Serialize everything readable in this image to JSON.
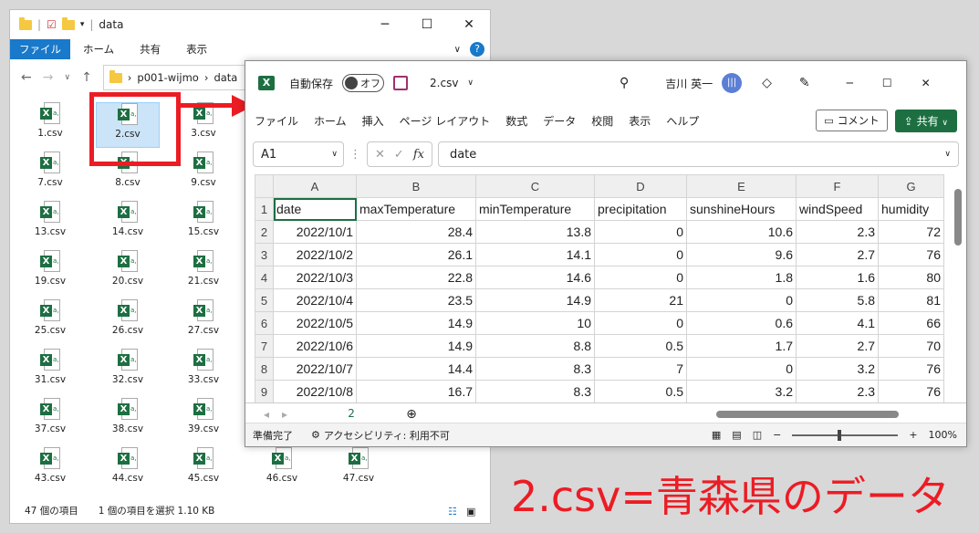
{
  "explorer": {
    "title": "data",
    "tabs": [
      "ファイル",
      "ホーム",
      "共有",
      "表示"
    ],
    "breadcrumb": [
      "p001-wijmo",
      "data"
    ],
    "files": [
      "1.csv",
      "2.csv",
      "3.csv",
      "7.csv",
      "8.csv",
      "9.csv",
      "13.csv",
      "14.csv",
      "15.csv",
      "19.csv",
      "20.csv",
      "21.csv",
      "25.csv",
      "26.csv",
      "27.csv",
      "31.csv",
      "32.csv",
      "33.csv",
      "37.csv",
      "38.csv",
      "39.csv",
      "43.csv",
      "44.csv",
      "45.csv",
      "46.csv",
      "47.csv"
    ],
    "selected_file": "2.csv",
    "status_count": "47 個の項目",
    "status_selected": "1 個の項目を選択  1.10 KB"
  },
  "excel": {
    "autosave_label": "自動保存",
    "autosave_state": "オフ",
    "file_name": "2.csv",
    "user": "吉川 英一",
    "menu": [
      "ファイル",
      "ホーム",
      "挿入",
      "ページ レイアウト",
      "数式",
      "データ",
      "校閲",
      "表示",
      "ヘルプ"
    ],
    "comment_label": "コメント",
    "share_label": "共有",
    "name_box": "A1",
    "formula_value": "date",
    "columns": [
      "A",
      "B",
      "C",
      "D",
      "E",
      "F",
      "G"
    ],
    "rows": [
      [
        "1",
        "date",
        "maxTemperature",
        "minTemperature",
        "precipitation",
        "sunshineHours",
        "windSpeed",
        "humidity"
      ],
      [
        "2",
        "2022/10/1",
        "28.4",
        "13.8",
        "0",
        "10.6",
        "2.3",
        "72"
      ],
      [
        "3",
        "2022/10/2",
        "26.1",
        "14.1",
        "0",
        "9.6",
        "2.7",
        "76"
      ],
      [
        "4",
        "2022/10/3",
        "22.8",
        "14.6",
        "0",
        "1.8",
        "1.6",
        "80"
      ],
      [
        "5",
        "2022/10/4",
        "23.5",
        "14.9",
        "21",
        "0",
        "5.8",
        "81"
      ],
      [
        "6",
        "2022/10/5",
        "14.9",
        "10",
        "0",
        "0.6",
        "4.1",
        "66"
      ],
      [
        "7",
        "2022/10/6",
        "14.9",
        "8.8",
        "0.5",
        "1.7",
        "2.7",
        "70"
      ],
      [
        "8",
        "2022/10/7",
        "14.4",
        "8.3",
        "7",
        "0",
        "3.2",
        "76"
      ],
      [
        "9",
        "2022/10/8",
        "16.7",
        "8.3",
        "0.5",
        "3.2",
        "2.3",
        "76"
      ]
    ],
    "sheet_tab": "2",
    "status_ready": "準備完了",
    "status_accessibility": "アクセシビリティ: 利用不可",
    "zoom": "100%"
  },
  "caption": "2.csv=青森県のデータ",
  "colors": {
    "accent_red": "#ec1c24",
    "excel_green": "#1d6f42",
    "explorer_blue": "#1979ca"
  }
}
